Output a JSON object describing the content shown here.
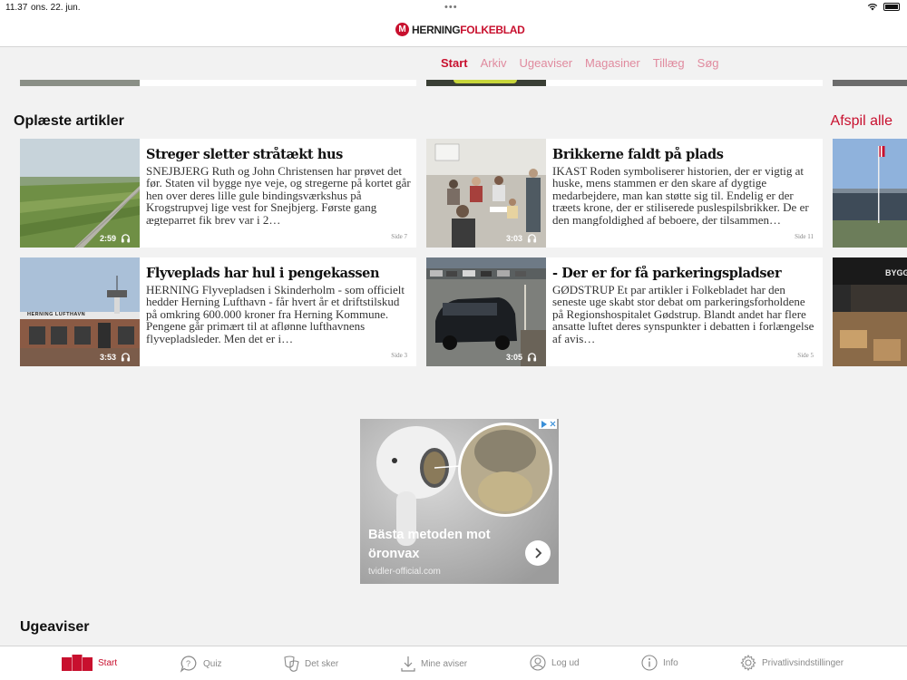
{
  "status_bar": {
    "time": "11.37",
    "date": "ons. 22. jun."
  },
  "brand": {
    "letter": "M",
    "name_part1": "HERNING",
    "name_part2": "FOLKEBLAD",
    "accent_color": "#c8102e"
  },
  "nav": {
    "tabs": [
      "Start",
      "Arkiv",
      "Ugeaviser",
      "Magasiner",
      "Tillæg",
      "Søg"
    ],
    "active": "Start"
  },
  "section": {
    "title": "Oplæste artikler",
    "play_all": "Afspil alle"
  },
  "articles": [
    {
      "headline": "Streger sletter stråtækt hus",
      "body": "SNEJBJERG Ruth og John Christensen har prøvet det før. Staten vil bygge nye veje, og stregerne på kortet går hen over deres lille gule bindingsværkshus på Krogstrupvej lige vest for Snejbjerg. Første gang ægteparret fik brev var i 2…",
      "duration": "2:59",
      "page": "Side 7"
    },
    {
      "headline": "Brikkerne faldt på plads",
      "body": "IKAST Roden symboliserer historien, der er vigtig at huske, mens stammen er den skare af dygtige medarbejdere, man kan støtte sig til. Endelig er der træets krone, der er stiliserede puslespilsbrikker. De er den mangfoldighed af beboere, der tilsammen…",
      "duration": "3:03",
      "page": "Side 11"
    },
    {
      "headline": "Flyveplads har hul i pengekassen",
      "body": "HERNING Flyvepladsen i Skinderholm - som officielt hedder Herning Lufthavn - får hvert år et driftstilskud på omkring 600.000 kroner fra Herning Kommune. Pengene går primært til at aflønne lufthavnens flyvepladsleder. Men det er i…",
      "duration": "3:53",
      "page": "Side 3",
      "sign_text": "HERNING LUFTHAVN"
    },
    {
      "headline": "- Der er for få parkeringspladser",
      "body": "GØDSTRUP Et par artikler i Folkebladet har den seneste uge skabt stor debat om parkeringsforholdene på Regionshospitalet Gødstrup. Blandt andet har flere ansatte luftet deres synspunkter i debatten i forlængelse af avis…",
      "duration": "3:05",
      "page": "Side 5"
    }
  ],
  "partial_sign_text": "BYGG",
  "ad": {
    "headline": "Bästa metoden mot öronvax",
    "source": "tvidler-official.com"
  },
  "section2": {
    "title": "Ugeaviser"
  },
  "tabbar": {
    "items": [
      {
        "label": "Start",
        "icon": "newspaper-icon",
        "active": true
      },
      {
        "label": "Quiz",
        "icon": "quiz-bubble-icon",
        "active": false
      },
      {
        "label": "Det sker",
        "icon": "masks-icon",
        "active": false
      },
      {
        "label": "Mine aviser",
        "icon": "download-icon",
        "active": false
      },
      {
        "label": "Log ud",
        "icon": "user-icon",
        "active": false
      },
      {
        "label": "Info",
        "icon": "info-icon",
        "active": false
      },
      {
        "label": "Privatlivsindstillinger",
        "icon": "gear-icon",
        "active": false
      }
    ]
  }
}
